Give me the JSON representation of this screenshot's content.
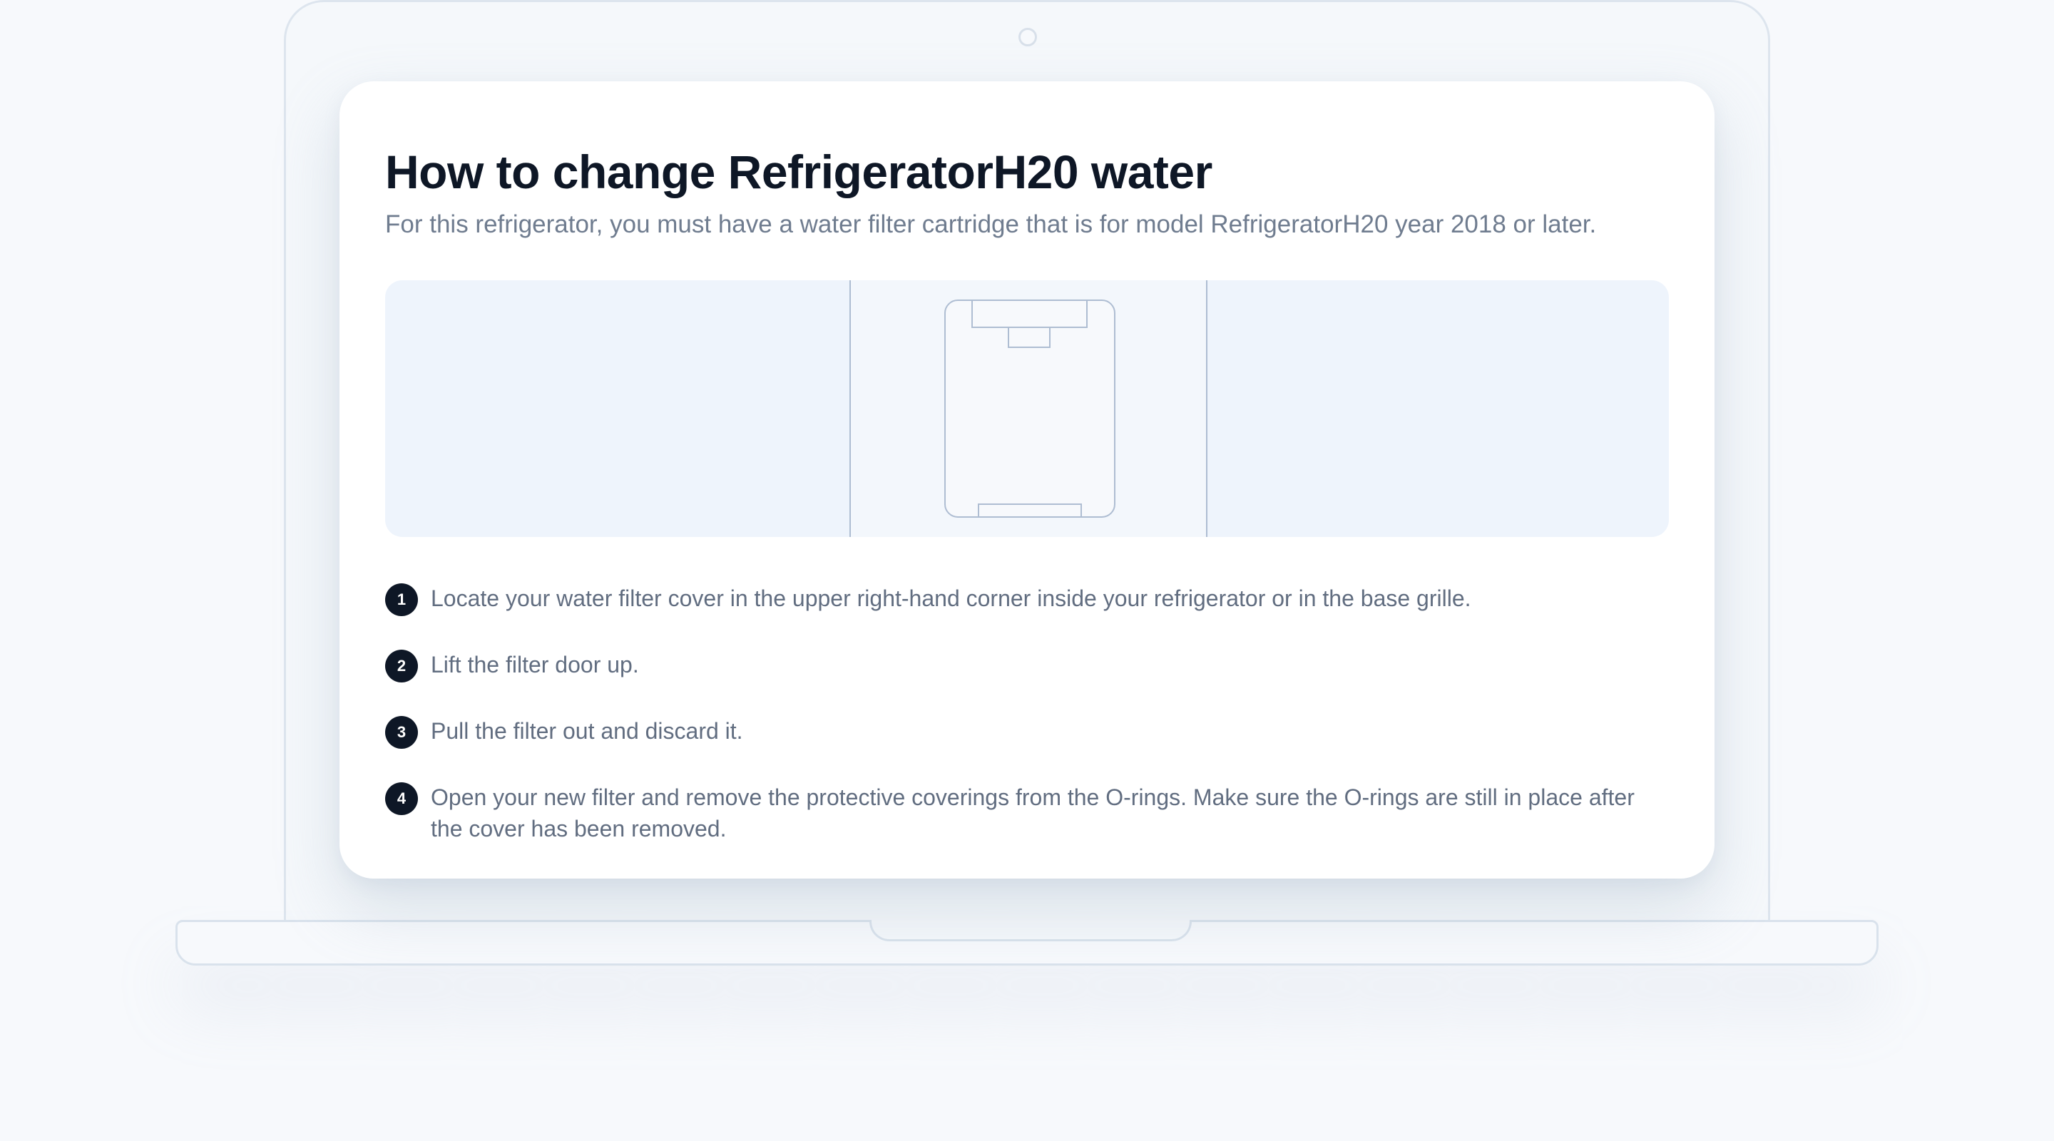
{
  "article": {
    "title": "How to change RefrigeratorH20 water",
    "subtitle": "For this refrigerator, you must have a water filter cartridge that is for model RefrigeratorH20 year 2018 or later."
  },
  "illustration": {
    "icon": "water-filter-cartridge-icon",
    "fill_color": "#eef4fc",
    "line_color": "#aebdd2"
  },
  "steps": [
    {
      "number": "1",
      "text": "Locate your water filter cover in the upper right-hand corner inside your refrigerator or in the base grille."
    },
    {
      "number": "2",
      "text": "Lift the filter door up."
    },
    {
      "number": "3",
      "text": "Pull the filter out and discard it."
    },
    {
      "number": "4",
      "text": "Open your new filter and remove the protective coverings from the O-rings. Make sure the O-rings are still in place after the cover has been removed."
    }
  ],
  "colors": {
    "title": "#0e1726",
    "body": "#616d80",
    "badge": "#0e1726"
  }
}
